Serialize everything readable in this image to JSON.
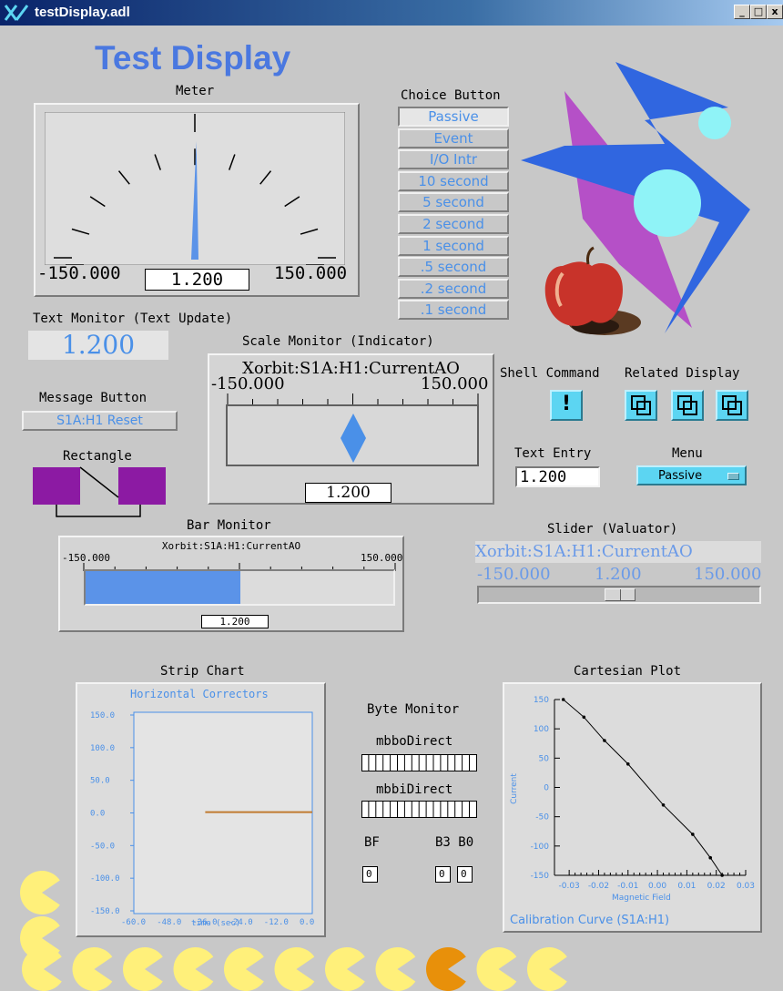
{
  "window": {
    "title": "testDisplay.adl"
  },
  "heading": "Test Display",
  "meter": {
    "label": "Meter",
    "min": "-150.000",
    "max": "150.000",
    "value": "1.200",
    "fraction": 0.504
  },
  "choice": {
    "label": "Choice Button",
    "options": [
      "Passive",
      "Event",
      "I/O Intr",
      "10 second",
      "5 second",
      "2 second",
      "1 second",
      ".5 second",
      ".2 second",
      ".1 second"
    ],
    "selected": "Passive"
  },
  "text_monitor": {
    "label": "Text Monitor (Text Update)",
    "value": "1.200"
  },
  "scale_monitor": {
    "label": "Scale Monitor (Indicator)",
    "channel": "Xorbit:S1A:H1:CurrentAO",
    "min": "-150.000",
    "max": "150.000",
    "value": "1.200",
    "fraction": 0.504
  },
  "message_button": {
    "label": "Message Button",
    "text": "S1A:H1 Reset"
  },
  "rectangle": {
    "label": "Rectangle"
  },
  "shell": {
    "label": "Shell Command",
    "glyph": "!"
  },
  "related": {
    "label": "Related Display"
  },
  "text_entry": {
    "label": "Text Entry",
    "value": "1.200"
  },
  "menu": {
    "label": "Menu",
    "value": "Passive"
  },
  "bar_monitor": {
    "label": "Bar Monitor",
    "channel": "Xorbit:S1A:H1:CurrentAO",
    "min": "-150.000",
    "max": "150.000",
    "value": "1.200",
    "fraction": 0.504
  },
  "slider": {
    "label": "Slider (Valuator)",
    "channel": "Xorbit:S1A:H1:CurrentAO",
    "min": "-150.000",
    "max": "150.000",
    "value": "1.200",
    "fraction": 0.504
  },
  "strip_chart": {
    "label": "Strip Chart",
    "title": "Horizontal Correctors",
    "xlabel": "time (sec)",
    "yticks": [
      "150.0",
      "100.0",
      "50.0",
      "0.0",
      "-50.0",
      "-100.0",
      "-150.0"
    ],
    "xticks": [
      "-60.0",
      "-48.0",
      "-36.0",
      "-24.0",
      "-12.0",
      "0.0"
    ]
  },
  "byte_monitor": {
    "label": "Byte Monitor",
    "mbbo": "mbboDirect",
    "mbbi": "mbbiDirect",
    "bf": "BF",
    "b3b0": "B3 B0",
    "v1": "0",
    "v2": "0",
    "v3": "0"
  },
  "cartesian": {
    "label": "Cartesian Plot",
    "title": "Calibration Curve (S1A:H1)",
    "xlabel": "Magnetic Field",
    "ylabel": "Current",
    "yticks": [
      "150",
      "100",
      "50",
      "0",
      "-50",
      "-100",
      "-150"
    ],
    "xticks": [
      "-0.03",
      "-0.02",
      "-0.01",
      "0.00",
      "0.01",
      "0.02",
      "0.03"
    ]
  },
  "colors": {
    "blue": "#4a90e8",
    "cyan": "#5cd5f2",
    "purple": "#8c1aa3",
    "yellow": "#fff07a",
    "orange": "#e8900a"
  },
  "chart_data": [
    {
      "type": "line",
      "title": "Horizontal Correctors",
      "xlabel": "time (sec)",
      "ylabel": "",
      "series": [
        {
          "values": [
            1.2,
            1.2
          ]
        }
      ],
      "x": [
        -36,
        0
      ],
      "xlim": [
        -60,
        0
      ],
      "ylim": [
        -150,
        150
      ]
    },
    {
      "type": "line",
      "title": "Calibration Curve (S1A:H1)",
      "xlabel": "Magnetic Field",
      "ylabel": "Current",
      "x": [
        -0.032,
        -0.025,
        -0.018,
        -0.01,
        0.002,
        0.012,
        0.018,
        0.022
      ],
      "y": [
        150,
        120,
        80,
        40,
        -30,
        -80,
        -120,
        -150
      ],
      "xlim": [
        -0.035,
        0.03
      ],
      "ylim": [
        -150,
        150
      ]
    }
  ]
}
